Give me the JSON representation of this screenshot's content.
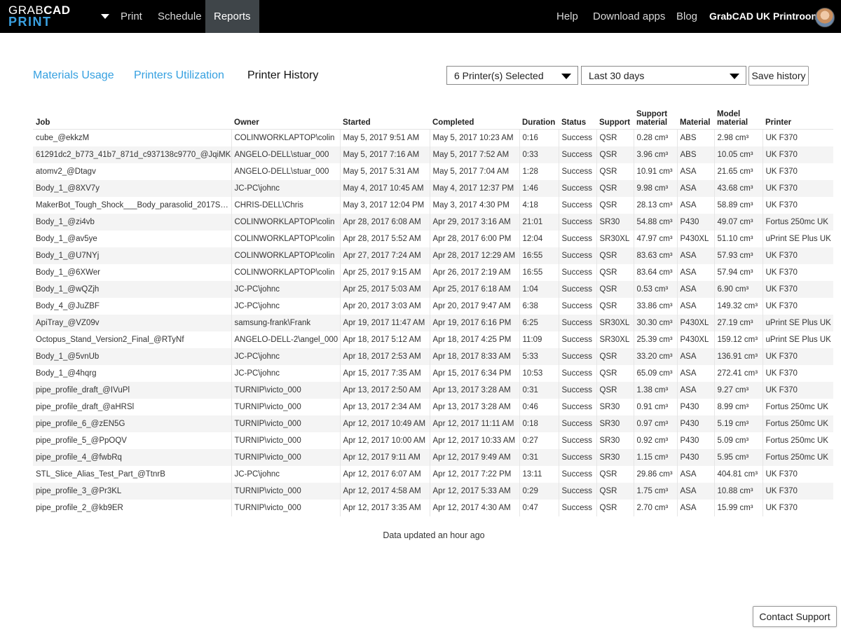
{
  "brand": {
    "line1_light": "GRAB",
    "line1_bold": "CAD",
    "line2": "PRINT"
  },
  "nav": {
    "left": [
      "Print",
      "Schedule",
      "Reports"
    ],
    "right": [
      "Help",
      "Download apps",
      "Blog"
    ],
    "printroom": "GrabCAD UK Printroom",
    "active": "Reports"
  },
  "tabs": {
    "materials": "Materials Usage",
    "printers": "Printers Utilization",
    "history": "Printer History"
  },
  "controls": {
    "printer_select": "6 Printer(s) Selected",
    "range_select": "Last 30 days",
    "save": "Save history"
  },
  "table": {
    "headers": {
      "job": "Job",
      "owner": "Owner",
      "started": "Started",
      "completed": "Completed",
      "duration": "Duration",
      "status": "Status",
      "support": "Support",
      "support_material_1": "Support",
      "support_material_2": "material",
      "material": "Material",
      "model_material_1": "Model",
      "model_material_2": "material",
      "printer": "Printer"
    },
    "rows": [
      [
        "cube_@ekkzM",
        "COLINWORKLAPTOP\\colin",
        "May 5, 2017 9:51 AM",
        "May 5, 2017 10:23 AM",
        "0:16",
        "Success",
        "QSR",
        "0.28 cm³",
        "ABS",
        "2.98 cm³",
        "UK F370"
      ],
      [
        "61291dc2_b773_41b7_871d_c937138c9770_@JqiMK",
        "ANGELO-DELL\\stuar_000",
        "May 5, 2017 7:16 AM",
        "May 5, 2017 7:52 AM",
        "0:33",
        "Success",
        "QSR",
        "3.96 cm³",
        "ABS",
        "10.05 cm³",
        "UK F370"
      ],
      [
        "atomv2_@Dtagv",
        "ANGELO-DELL\\stuar_000",
        "May 5, 2017 5:31 AM",
        "May 5, 2017 7:04 AM",
        "1:28",
        "Success",
        "QSR",
        "10.91 cm³",
        "ASA",
        "21.65 cm³",
        "UK F370"
      ],
      [
        "Body_1_@8XV7y",
        "JC-PC\\johnc",
        "May 4, 2017 10:45 AM",
        "May 4, 2017 12:37 PM",
        "1:46",
        "Success",
        "QSR",
        "9.98 cm³",
        "ASA",
        "43.68 cm³",
        "UK F370"
      ],
      [
        "MakerBot_Tough_Shock___Body_parasolid_2017SP…",
        "CHRIS-DELL\\Chris",
        "May 3, 2017 12:04 PM",
        "May 3, 2017 4:30 PM",
        "4:18",
        "Success",
        "QSR",
        "28.13 cm³",
        "ASA",
        "58.89 cm³",
        "UK F370"
      ],
      [
        "Body_1_@zi4vb",
        "COLINWORKLAPTOP\\colin",
        "Apr 28, 2017 6:08 AM",
        "Apr 29, 2017 3:16 AM",
        "21:01",
        "Success",
        "SR30",
        "54.88 cm³",
        "P430",
        "49.07 cm³",
        "Fortus 250mc UK"
      ],
      [
        "Body_1_@av5ye",
        "COLINWORKLAPTOP\\colin",
        "Apr 28, 2017 5:52 AM",
        "Apr 28, 2017 6:00 PM",
        "12:04",
        "Success",
        "SR30XL",
        "47.97 cm³",
        "P430XL",
        "51.10 cm³",
        "uPrint SE Plus UK"
      ],
      [
        "Body_1_@U7NYj",
        "COLINWORKLAPTOP\\colin",
        "Apr 27, 2017 7:24 AM",
        "Apr 28, 2017 12:29 AM",
        "16:55",
        "Success",
        "QSR",
        "83.63 cm³",
        "ASA",
        "57.93 cm³",
        "UK F370"
      ],
      [
        "Body_1_@6XWer",
        "COLINWORKLAPTOP\\colin",
        "Apr 25, 2017 9:15 AM",
        "Apr 26, 2017 2:19 AM",
        "16:55",
        "Success",
        "QSR",
        "83.64 cm³",
        "ASA",
        "57.94 cm³",
        "UK F370"
      ],
      [
        "Body_1_@wQZjh",
        "JC-PC\\johnc",
        "Apr 25, 2017 5:03 AM",
        "Apr 25, 2017 6:18 AM",
        "1:04",
        "Success",
        "QSR",
        "0.53 cm³",
        "ASA",
        "6.90 cm³",
        "UK F370"
      ],
      [
        "Body_4_@JuZBF",
        "JC-PC\\johnc",
        "Apr 20, 2017 3:03 AM",
        "Apr 20, 2017 9:47 AM",
        "6:38",
        "Success",
        "QSR",
        "33.86 cm³",
        "ASA",
        "149.32 cm³",
        "UK F370"
      ],
      [
        "ApiTray_@VZ09v",
        "samsung-frank\\Frank",
        "Apr 19, 2017 11:47 AM",
        "Apr 19, 2017 6:16 PM",
        "6:25",
        "Success",
        "SR30XL",
        "30.30 cm³",
        "P430XL",
        "27.19 cm³",
        "uPrint SE Plus UK"
      ],
      [
        "Octopus_Stand_Version2_Final_@RTyNf",
        "ANGELO-DELL-2\\angel_000",
        "Apr 18, 2017 5:12 AM",
        "Apr 18, 2017 4:25 PM",
        "11:09",
        "Success",
        "SR30XL",
        "25.39 cm³",
        "P430XL",
        "159.12 cm³",
        "uPrint SE Plus UK"
      ],
      [
        "Body_1_@5vnUb",
        "JC-PC\\johnc",
        "Apr 18, 2017 2:53 AM",
        "Apr 18, 2017 8:33 AM",
        "5:33",
        "Success",
        "QSR",
        "33.20 cm³",
        "ASA",
        "136.91 cm³",
        "UK F370"
      ],
      [
        "Body_1_@4hqrg",
        "JC-PC\\johnc",
        "Apr 15, 2017 7:35 AM",
        "Apr 15, 2017 6:34 PM",
        "10:53",
        "Success",
        "QSR",
        "65.09 cm³",
        "ASA",
        "272.41 cm³",
        "UK F370"
      ],
      [
        "pipe_profile_draft_@IVuPl",
        "TURNIP\\victo_000",
        "Apr 13, 2017 2:50 AM",
        "Apr 13, 2017 3:28 AM",
        "0:31",
        "Success",
        "QSR",
        "1.38 cm³",
        "ASA",
        "9.27 cm³",
        "UK F370"
      ],
      [
        "pipe_profile_draft_@aHRSl",
        "TURNIP\\victo_000",
        "Apr 13, 2017 2:34 AM",
        "Apr 13, 2017 3:28 AM",
        "0:46",
        "Success",
        "SR30",
        "0.91 cm³",
        "P430",
        "8.99 cm³",
        "Fortus 250mc UK"
      ],
      [
        "pipe_profile_6_@zEN5G",
        "TURNIP\\victo_000",
        "Apr 12, 2017 10:49 AM",
        "Apr 12, 2017 11:11 AM",
        "0:18",
        "Success",
        "SR30",
        "0.97 cm³",
        "P430",
        "5.19 cm³",
        "Fortus 250mc UK"
      ],
      [
        "pipe_profile_5_@PpOQV",
        "TURNIP\\victo_000",
        "Apr 12, 2017 10:00 AM",
        "Apr 12, 2017 10:33 AM",
        "0:27",
        "Success",
        "SR30",
        "0.92 cm³",
        "P430",
        "5.09 cm³",
        "Fortus 250mc UK"
      ],
      [
        "pipe_profile_4_@fwbRq",
        "TURNIP\\victo_000",
        "Apr 12, 2017 9:11 AM",
        "Apr 12, 2017 9:49 AM",
        "0:31",
        "Success",
        "SR30",
        "1.15 cm³",
        "P430",
        "5.95 cm³",
        "Fortus 250mc UK"
      ],
      [
        "STL_Slice_Alias_Test_Part_@TtnrB",
        "JC-PC\\johnc",
        "Apr 12, 2017 6:07 AM",
        "Apr 12, 2017 7:22 PM",
        "13:11",
        "Success",
        "QSR",
        "29.86 cm³",
        "ASA",
        "404.81 cm³",
        "UK F370"
      ],
      [
        "pipe_profile_3_@Pr3KL",
        "TURNIP\\victo_000",
        "Apr 12, 2017 4:58 AM",
        "Apr 12, 2017 5:33 AM",
        "0:29",
        "Success",
        "QSR",
        "1.75 cm³",
        "ASA",
        "10.88 cm³",
        "UK F370"
      ],
      [
        "pipe_profile_2_@kb9ER",
        "TURNIP\\victo_000",
        "Apr 12, 2017 3:35 AM",
        "Apr 12, 2017 4:30 AM",
        "0:47",
        "Success",
        "QSR",
        "2.70 cm³",
        "ASA",
        "15.99 cm³",
        "UK F370"
      ]
    ]
  },
  "footer": {
    "updated": "Data updated an hour ago",
    "contact": "Contact Support"
  },
  "colors": {
    "accent": "#35a0e0",
    "topbar": "#000000",
    "active_tab": "#3f4549",
    "row_stripe": "#f4f4f4"
  },
  "icons": [
    "dropdown-caret-icon",
    "chevron-down-icon",
    "avatar"
  ]
}
